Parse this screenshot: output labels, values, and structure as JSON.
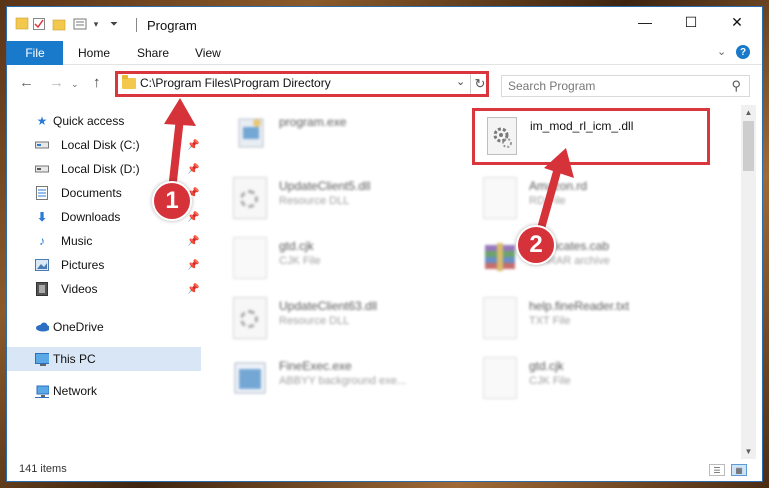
{
  "window": {
    "title": "Program",
    "controls": {
      "minimize": "—",
      "maximize": "☐",
      "close": "✕"
    }
  },
  "ribbon": {
    "tabs": [
      {
        "label": "File"
      },
      {
        "label": "Home"
      },
      {
        "label": "Share"
      },
      {
        "label": "View"
      }
    ],
    "help": "?"
  },
  "nav": {
    "address": "C:\\Program Files\\Program Directory",
    "search_placeholder": "Search Program"
  },
  "sidebar": {
    "items": [
      {
        "label": "Quick access",
        "icon": "star-icon",
        "pinned": false
      },
      {
        "label": "Local Disk (C:)",
        "icon": "drive-icon",
        "pinned": true
      },
      {
        "label": "Local Disk (D:)",
        "icon": "drive-icon",
        "pinned": true
      },
      {
        "label": "Documents",
        "icon": "documents-icon",
        "pinned": true
      },
      {
        "label": "Downloads",
        "icon": "download-icon",
        "pinned": true
      },
      {
        "label": "Music",
        "icon": "music-icon",
        "pinned": true
      },
      {
        "label": "Pictures",
        "icon": "pictures-icon",
        "pinned": true
      },
      {
        "label": "Videos",
        "icon": "videos-icon",
        "pinned": true
      },
      {
        "label": "OneDrive",
        "icon": "cloud-icon",
        "pinned": false
      },
      {
        "label": "This PC",
        "icon": "pc-icon",
        "pinned": false,
        "selected": true
      },
      {
        "label": "Network",
        "icon": "network-icon",
        "pinned": false
      }
    ]
  },
  "files": [
    {
      "name": "program.exe",
      "type": "",
      "icon": "exe-icon"
    },
    {
      "name": "im_mod_rl_icm_.dll",
      "type": "",
      "icon": "dll-gear-icon",
      "highlighted": true
    },
    {
      "name": "UpdateClient5.dll",
      "type": "Resource DLL",
      "icon": "dll-gear-icon"
    },
    {
      "name": "Amazon.rd",
      "type": "RD File",
      "icon": "file-icon"
    },
    {
      "name": "gtd.cjk",
      "type": "CJK File",
      "icon": "file-icon"
    },
    {
      "name": "certificates.cab",
      "type": "WinRAR archive",
      "icon": "rar-icon"
    },
    {
      "name": "UpdateClient63.dll",
      "type": "Resource DLL",
      "icon": "dll-gear-icon"
    },
    {
      "name": "help.fineReader.txt",
      "type": "TXT File",
      "icon": "file-icon"
    },
    {
      "name": "FineExec.exe",
      "type": "ABBYY background exe...",
      "icon": "app-icon"
    },
    {
      "name": "gtd.cjk",
      "type": "CJK File",
      "icon": "file-icon"
    }
  ],
  "status": {
    "items": "141 items"
  },
  "callouts": [
    {
      "number": "1"
    },
    {
      "number": "2"
    }
  ],
  "colors": {
    "accent": "#1979ca",
    "callout": "#d6323a",
    "selected": "#d9e6f5"
  }
}
